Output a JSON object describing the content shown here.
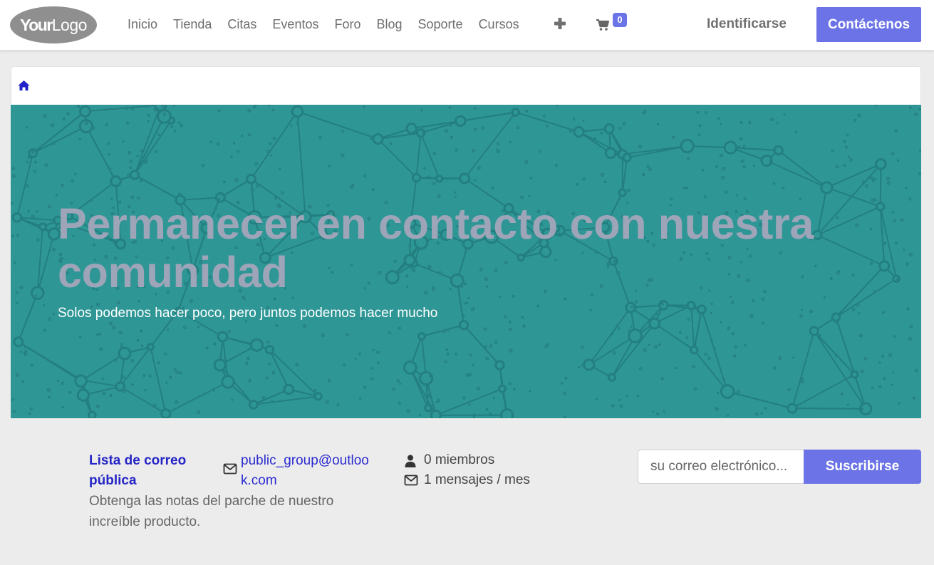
{
  "colors": {
    "accent": "#6b73e6",
    "hero_bg": "#2f9696",
    "hero_title": "#9ea5b8",
    "link": "#2b2bd0"
  },
  "header": {
    "logo": {
      "part1": "Your",
      "part2": "Logo"
    },
    "nav": [
      "Inicio",
      "Tienda",
      "Citas",
      "Eventos",
      "Foro",
      "Blog",
      "Soporte",
      "Cursos"
    ],
    "more_icon": "plus-icon",
    "cart": {
      "icon": "shopping-cart-icon",
      "count": "0"
    },
    "login_label": "Identificarse",
    "contact_label": "Contáctenos"
  },
  "breadcrumb": {
    "icon": "home-icon"
  },
  "hero": {
    "title": "Permanecer en contacto con nuestra comunidad",
    "subtitle": "Solos podemos hacer poco, pero juntos podemos hacer mucho"
  },
  "mailing_list": {
    "title": "Lista de correo pública",
    "description": "Obtenga las notas del parche de nuestro increíble producto.",
    "email": "public_group@outlook.com",
    "members": "0 miembros",
    "messages": "1 mensajes / mes",
    "input_placeholder": "su correo electrónico...",
    "subscribe_label": "Suscribirse"
  }
}
